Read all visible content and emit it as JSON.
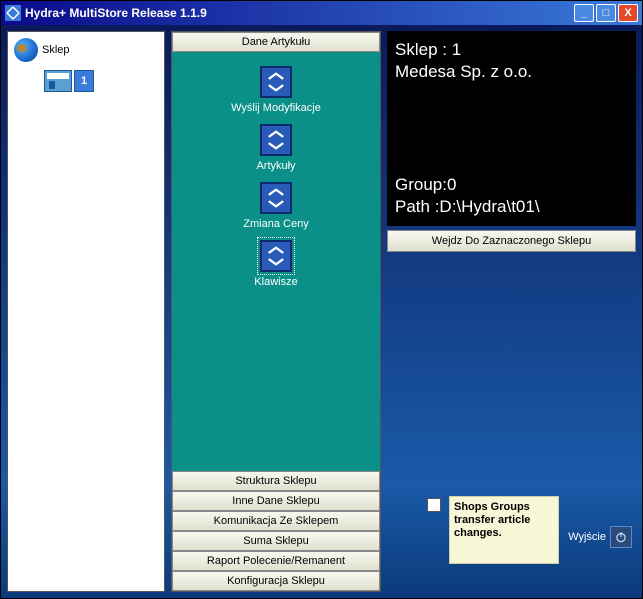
{
  "window": {
    "title": "Hydra+ MultiStore Release 1.1.9"
  },
  "tree": {
    "root_label": "Sklep",
    "child_number": "1"
  },
  "center": {
    "header": "Dane Artykułu",
    "actions": [
      {
        "label": "Wyślij Modyfikacje"
      },
      {
        "label": "Artykuły"
      },
      {
        "label": "Zmiana Ceny"
      },
      {
        "label": "Klawisze"
      }
    ],
    "bottom_buttons": [
      "Struktura Sklepu",
      "Inne Dane Sklepu",
      "Komunikacja Ze Sklepem",
      "Suma Sklepu",
      "Raport Polecenie/Remanent",
      "Konfiguracja Sklepu"
    ]
  },
  "info": {
    "line1": "Sklep : 1",
    "line2": "Medesa Sp. z o.o.",
    "line3": "Group:0",
    "line4": "Path :D:\\Hydra\\t01\\",
    "enter_button": "Wejdz Do Zaznaczonego Sklepu"
  },
  "note": "Shops Groups transfer article changes.",
  "exit_label": "Wyjście"
}
